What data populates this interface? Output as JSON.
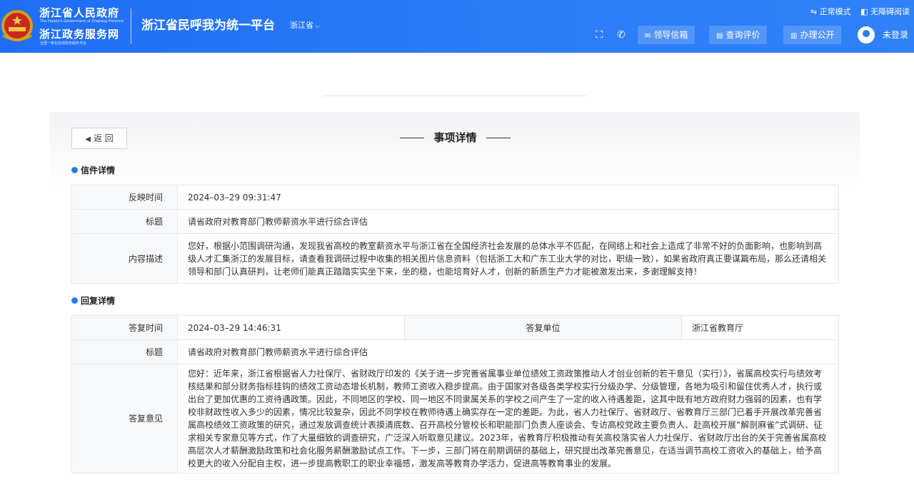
{
  "header": {
    "gov_name": "浙江省人民政府",
    "gov_name_en": "The People's Government of Zhejiang Province",
    "service_name": "浙江政务服务网",
    "service_sub": "全国一体化在线政务服务平台",
    "platform_title": "浙江省民呼我为统一平台",
    "region": "浙江省",
    "mode_normal": "⇋ 正常模式",
    "mode_accessible": "◧ 无障碍阅读",
    "btn_leader_mailbox": "领导信箱",
    "btn_query_review": "查询评价",
    "btn_public": "办理公开",
    "login": "未登录",
    "colors": {
      "brand": "#2b7cf7",
      "header_bg": "#1f6ef5"
    }
  },
  "main": {
    "back_label": "返 回",
    "page_title": "事项详情",
    "letter_section_title": "信件详情",
    "reply_section_title": "回复详情"
  },
  "letter": {
    "time_label": "反映时间",
    "time_value": "2024–03–29 09:31:47",
    "title_label": "标题",
    "title_value": "请省政府对教育部门教师薪资水平进行综合评估",
    "content_label": "内容描述",
    "content_value": "您好，根据小范围调研沟通，发现我省高校的教室薪资水平与浙江省在全国经济社会发展的总体水平不匹配，在网络上和社会上造成了非常不好的负面影响，也影响到高级人才汇集浙江的发展目标，请查看我调研过程中收集的相关图片信息资料（包括浙工大和广东工业大学的对比，职级一致），如果省政府真正要谋篇布局，那么还请相关领导和部门认真研判，让老师们能真正踏踏实实坐下来，坐的稳，也能培育好人才，创新的新质生产力才能被激发出来，多谢理解支持！"
  },
  "reply": {
    "time_label": "答复时间",
    "time_value": "2024–03–29 14:46:31",
    "unit_label": "答复单位",
    "unit_value": "浙江省教育厅",
    "title_label": "标题",
    "title_value": "请省政府对教育部门教师薪资水平进行综合评估",
    "opinion_label": "答复意见",
    "opinion_value": "您好：近年来，浙江省根据省人力社保厅、省财政厅印发的《关于进一步完善省属事业单位绩效工资政策推动人才创业创新的若干意见（实行）》，省属高校实行与绩效考核结果和部分财务指标挂钩的绩效工资动态增长机制，教师工资收入稳步提高。由于国家对各级各类学校实行分级办学、分级管理，各地为吸引和留住优秀人才，执行或出台了更加优惠的工资待遇政策。因此，不同地区的学校、同一地区不同隶属关系的学校之间产生了一定的收入待遇差距，这其中既有地方政府财力强弱的因素，也有学校非财政性收入多少的因素，情况比较复杂，因此不同学校在教师待遇上确实存在一定的差距。为此，省人力社保厅、省财政厅、省教育厅三部门已着手开展改革完善省属高校绩效工资政策的研究，通过发放调查统计表摸清底数、召开高校分管校长和职能部门负责人座谈会、专访高校党政主要负责人、赴高校开展“解剖麻雀”式调研、征求相关专家意见等方式，作了大量细致的调查研究，广泛深入听取意见建议。2023年，省教育厅积极推动有关高校落实省人力社保厅、省财政厅出台的关于完善省属高校高层次人才薪酬激励政策和社会化服务薪酬激励试点工作。下一步，三部门将在前期调研的基础上，研究提出改革完善意见，在适当调节高校工资收入的基础上，给予高校更大的收入分配自主权，进一步提高教职工的职业幸福感，激发高等教育办学活力，促进高等教育事业的发展。"
  }
}
